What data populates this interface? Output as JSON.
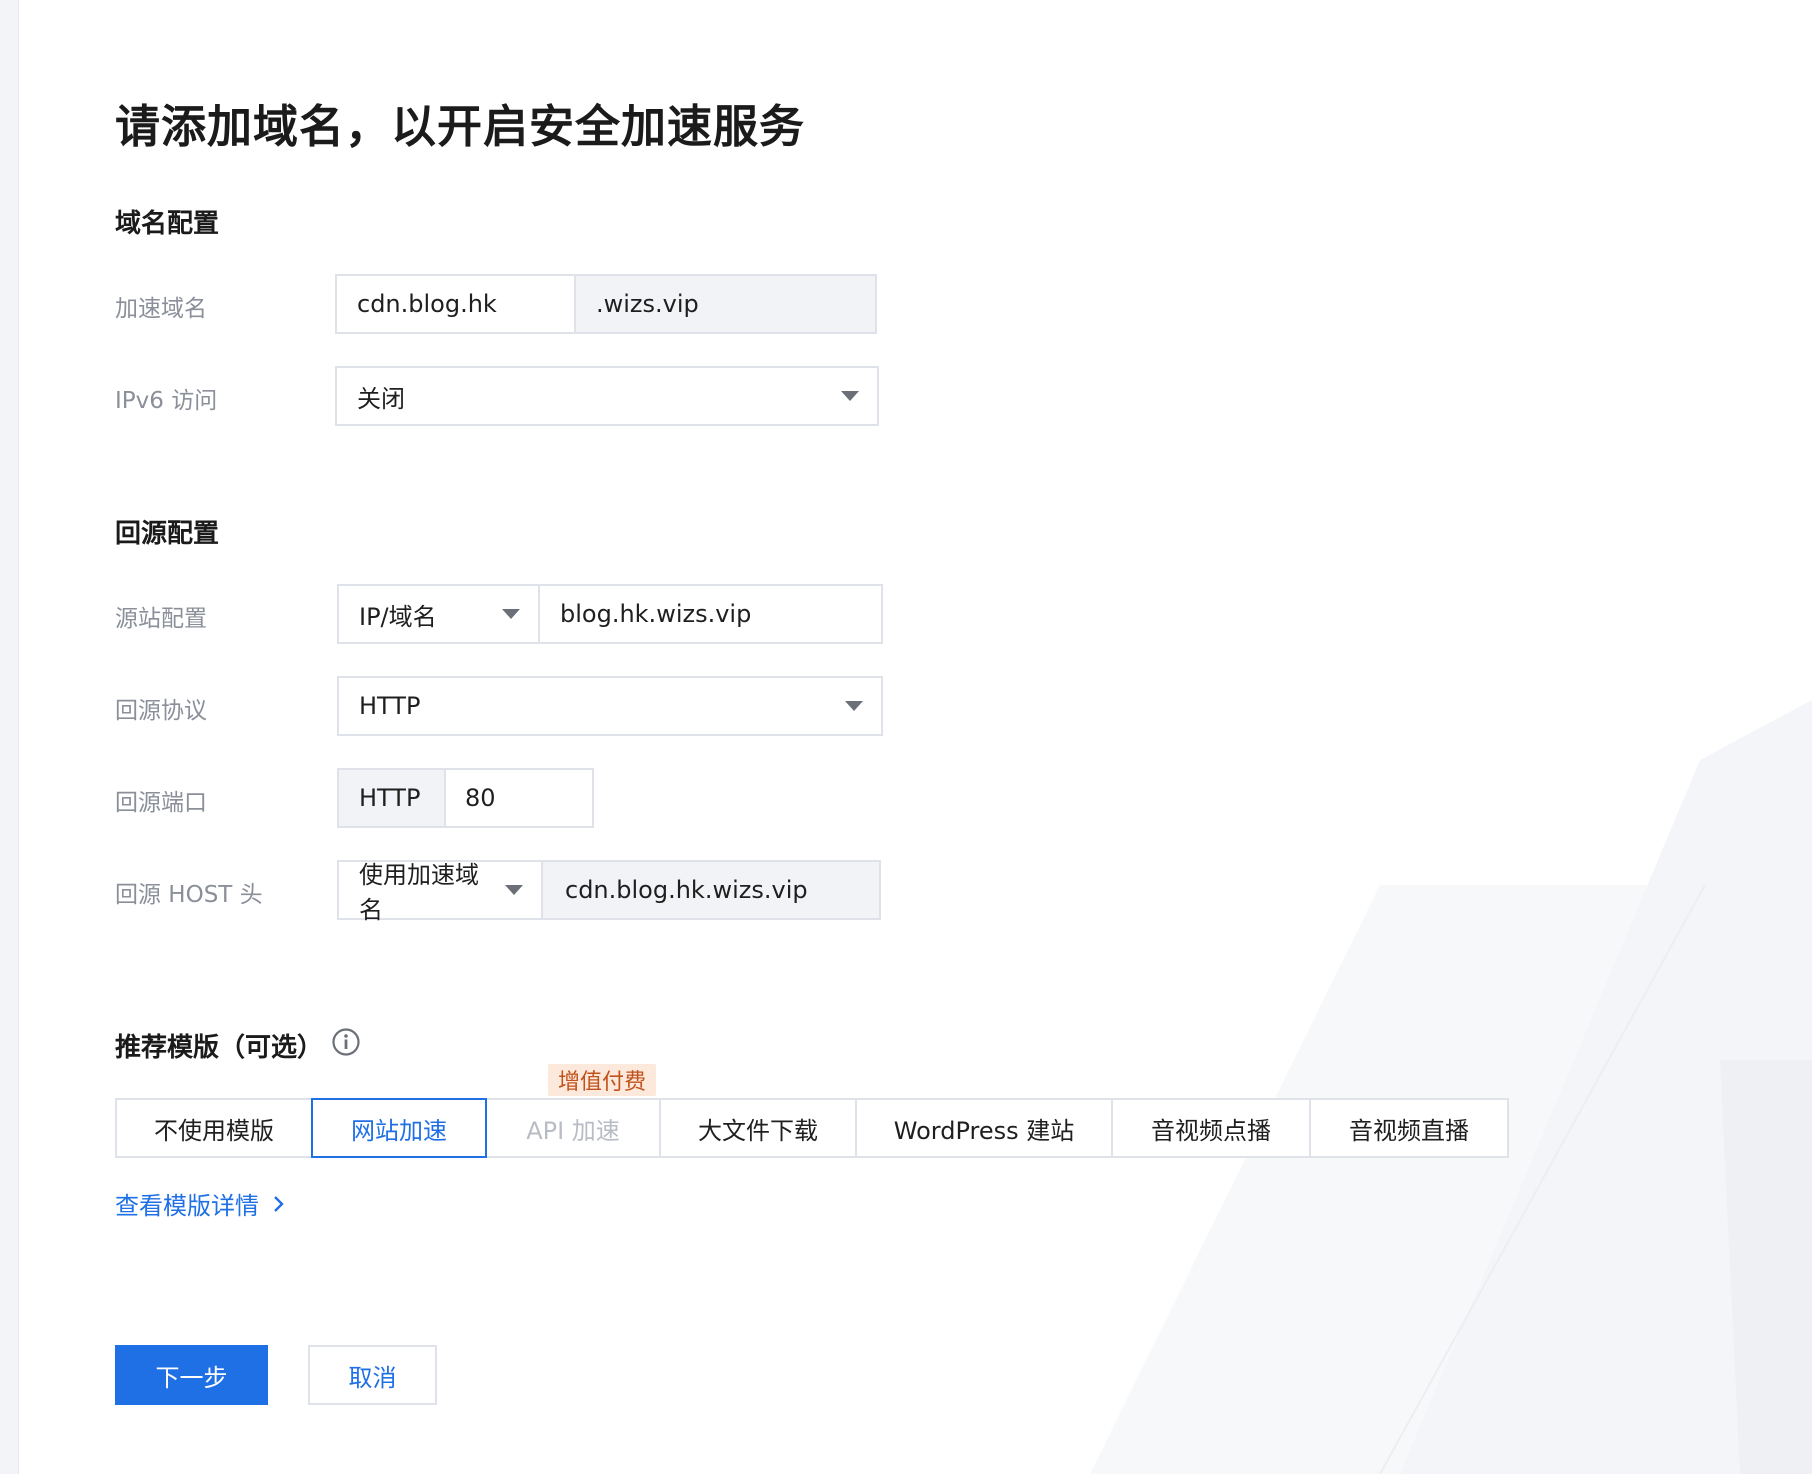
{
  "page": {
    "title": "请添加域名，以开启安全加速服务"
  },
  "domain_config": {
    "section_title": "域名配置",
    "accel_domain": {
      "label": "加速域名",
      "prefix_value": "cdn.blog.hk",
      "suffix_value": ".wizs.vip"
    },
    "ipv6": {
      "label": "IPv6 访问",
      "selected": "关闭"
    }
  },
  "origin_config": {
    "section_title": "回源配置",
    "origin_site": {
      "label": "源站配置",
      "type_selected": "IP/域名",
      "value": "blog.hk.wizs.vip"
    },
    "origin_protocol": {
      "label": "回源协议",
      "selected": "HTTP"
    },
    "origin_port": {
      "label": "回源端口",
      "protocol_tag": "HTTP",
      "value": "80"
    },
    "origin_host": {
      "label": "回源 HOST 头",
      "mode_selected": "使用加速域名",
      "value": "cdn.blog.hk.wizs.vip"
    }
  },
  "templates": {
    "section_title": "推荐模版（可选）",
    "badge": "增值付费",
    "options": [
      {
        "label": "不使用模版"
      },
      {
        "label": "网站加速"
      },
      {
        "label": "API 加速"
      },
      {
        "label": "大文件下载"
      },
      {
        "label": "WordPress 建站"
      },
      {
        "label": "音视频点播"
      },
      {
        "label": "音视频直播"
      }
    ],
    "details_link": "查看模版详情"
  },
  "actions": {
    "next": "下一步",
    "cancel": "取消"
  },
  "colors": {
    "accent": "#1f6fe5",
    "badge_bg": "#fde9dc",
    "badge_text": "#c0521d"
  }
}
